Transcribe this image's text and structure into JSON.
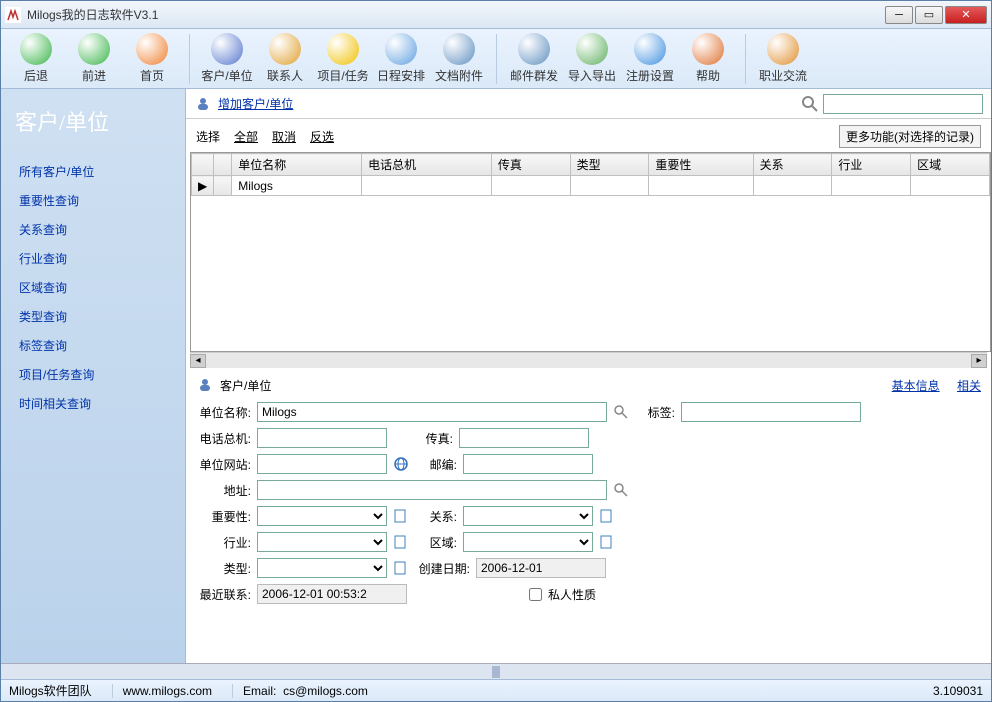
{
  "window": {
    "title": "Milogs我的日志软件V3.1"
  },
  "toolbar": [
    {
      "label": "后退",
      "color": "#3ab54a"
    },
    {
      "label": "前进",
      "color": "#3ab54a"
    },
    {
      "label": "首页",
      "color": "#f08030"
    }
  ],
  "toolbar2": [
    {
      "label": "客户/单位",
      "color": "#5577cc"
    },
    {
      "label": "联系人",
      "color": "#e0a030"
    },
    {
      "label": "项目/任务",
      "color": "#f0c000"
    },
    {
      "label": "日程安排",
      "color": "#60a0e0"
    },
    {
      "label": "文档附件",
      "color": "#6090c0"
    }
  ],
  "toolbar3": [
    {
      "label": "邮件群发",
      "color": "#6090c0"
    },
    {
      "label": "导入导出",
      "color": "#60b060"
    },
    {
      "label": "注册设置",
      "color": "#4090e0"
    },
    {
      "label": "帮助",
      "color": "#e07030"
    }
  ],
  "toolbar4": [
    {
      "label": "职业交流",
      "color": "#e09030"
    }
  ],
  "sidebar": {
    "title": "客户/单位",
    "items": [
      "所有客户/单位",
      "重要性查询",
      "关系查询",
      "行业查询",
      "区域查询",
      "类型查询",
      "标签查询",
      "项目/任务查询",
      "时间相关查询"
    ]
  },
  "action_bar": {
    "add_label": "增加客户/单位"
  },
  "select_row": {
    "label": "选择",
    "all": "全部",
    "cancel": "取消",
    "invert": "反选",
    "more": "更多功能(对选择的记录)"
  },
  "grid": {
    "columns": [
      "",
      "",
      "单位名称",
      "电话总机",
      "传真",
      "类型",
      "重要性",
      "关系",
      "行业",
      "区域"
    ],
    "rows": [
      {
        "name": "Milogs",
        "phone": "",
        "fax": "",
        "type": "",
        "importance": "",
        "relation": "",
        "industry": "",
        "region": ""
      }
    ]
  },
  "detail": {
    "title": "客户/单位",
    "tab_basic": "基本信息",
    "tab_rel": "相关",
    "fields": {
      "unit_name_lbl": "单位名称:",
      "unit_name": "Milogs",
      "tag_lbl": "标签:",
      "tag": "",
      "phone_lbl": "电话总机:",
      "phone": "",
      "fax_lbl": "传真:",
      "fax": "",
      "website_lbl": "单位网站:",
      "website": "",
      "zip_lbl": "邮编:",
      "zip": "",
      "addr_lbl": "地址:",
      "addr": "",
      "importance_lbl": "重要性:",
      "importance": "",
      "relation_lbl": "关系:",
      "relation": "",
      "industry_lbl": "行业:",
      "industry": "",
      "region_lbl": "区域:",
      "region": "",
      "type_lbl": "类型:",
      "type": "",
      "create_lbl": "创建日期:",
      "create": "2006-12-01",
      "last_lbl": "最近联系:",
      "last": "2006-12-01 00:53:2",
      "private_lbl": "私人性质"
    }
  },
  "statusbar": {
    "team": "Milogs软件团队",
    "site": "www.milogs.com",
    "email_lbl": "Email:",
    "email": "cs@milogs.com",
    "version": "3.109031"
  }
}
